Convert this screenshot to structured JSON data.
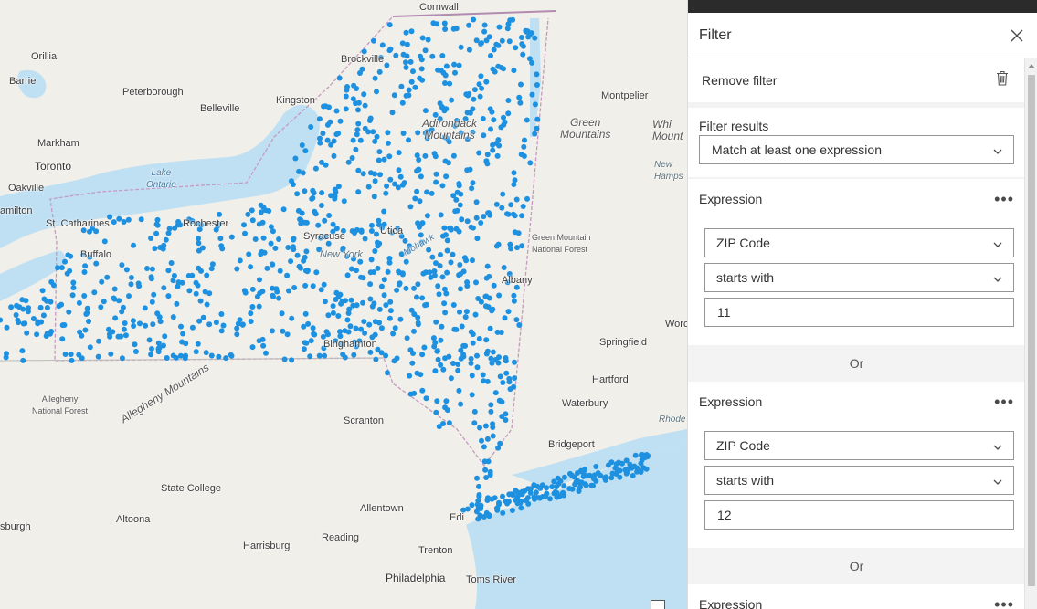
{
  "map": {
    "labels": {
      "cornwall": "Cornwall",
      "orillia": "Orillia",
      "barrie": "Barrie",
      "peterborough": "Peterborough",
      "brockville": "Brockville",
      "kingston": "Kingston",
      "belleville": "Belleville",
      "markham": "Markham",
      "toronto": "Toronto",
      "oakville": "Oakville",
      "hamilton": "amilton",
      "lake_ontario": "Lake\nOntario",
      "st_catharines": "St. Catharines",
      "rochester": "Rochester",
      "buffalo": "Buffalo",
      "syracuse": "Syracuse",
      "utica": "Utica",
      "new_york": "New York",
      "mohawk": "Mohawk",
      "albany": "Albany",
      "binghamton": "Binghamton",
      "adirondack": "Adirondack\nMountains",
      "montpelier": "Montpelier",
      "green_mountains": "Green\nMountains",
      "white_mount": "Whi\nMount",
      "new_hamps": "New\nHamps",
      "green_mountain_nf": "Green Mountain\nNational Forest",
      "worc": "Worc",
      "springfield": "Springfield",
      "hartford": "Hartford",
      "waterbury": "Waterbury",
      "rhode": "Rhode",
      "bridgeport": "Bridgeport",
      "allegheny_nf": "Allegheny\nNational Forest",
      "allegheny_mtn": "Allegheny Mountains",
      "scranton": "Scranton",
      "state_college": "State College",
      "allentown": "Allentown",
      "altoona": "Altoona",
      "reading": "Reading",
      "harrisburg": "Harrisburg",
      "trenton": "Trenton",
      "philadelphia": "Philadelphia",
      "toms_river": "Toms River",
      "sburgh": "sburgh",
      "edi": "Edi"
    },
    "colors": {
      "land": "#f1efe9",
      "water": "#bfe0f3",
      "points": "#1e90e0",
      "boundary": "#c59ac0"
    }
  },
  "panel": {
    "title": "Filter",
    "remove_filter": "Remove filter",
    "filter_results_label": "Filter results",
    "filter_results_value": "Match at least one expression",
    "expressions": [
      {
        "label": "Expression",
        "field": "ZIP Code",
        "operator": "starts with",
        "value": "11"
      },
      {
        "label": "Expression",
        "field": "ZIP Code",
        "operator": "starts with",
        "value": "12"
      },
      {
        "label": "Expression"
      }
    ],
    "or_label": "Or"
  }
}
